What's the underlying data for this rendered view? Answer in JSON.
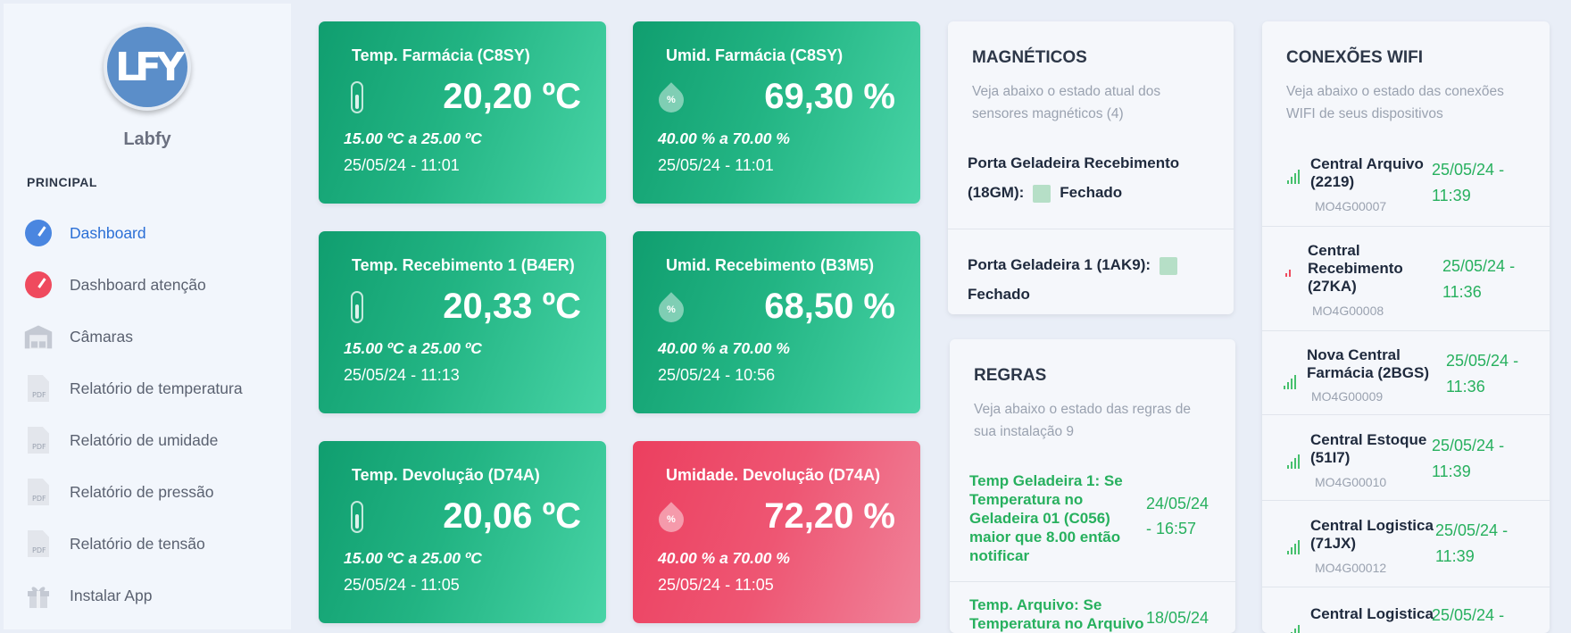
{
  "sidebar": {
    "logo_text": "LFY",
    "brand": "Labfy",
    "section": "PRINCIPAL",
    "items": [
      {
        "label": "Dashboard",
        "icon": "gauge-blue-icon"
      },
      {
        "label": "Dashboard atenção",
        "icon": "gauge-red-icon"
      },
      {
        "label": "Câmaras",
        "icon": "warehouse-icon"
      },
      {
        "label": "Relatório de temperatura",
        "icon": "pdf-icon"
      },
      {
        "label": "Relatório de umidade",
        "icon": "pdf-icon"
      },
      {
        "label": "Relatório de pressão",
        "icon": "pdf-icon"
      },
      {
        "label": "Relatório de tensão",
        "icon": "pdf-icon"
      },
      {
        "label": "Instalar App",
        "icon": "gift-icon"
      }
    ]
  },
  "cards": [
    {
      "title": "Temp. Farmácia (C8SY)",
      "value": "20,20 ºC",
      "range": "15.00 ºC a 25.00 ºC",
      "time": "25/05/24 - 11:01",
      "kind": "temperature",
      "status": "ok"
    },
    {
      "title": "Umid. Farmácia (C8SY)",
      "value": "69,30 %",
      "range": "40.00 % a 70.00 %",
      "time": "25/05/24 - 11:01",
      "kind": "humidity",
      "status": "ok"
    },
    {
      "title": "Temp. Recebimento 1 (B4ER)",
      "value": "20,33 ºC",
      "range": "15.00 ºC a 25.00 ºC",
      "time": "25/05/24 - 11:13",
      "kind": "temperature",
      "status": "ok"
    },
    {
      "title": "Umid. Recebimento (B3M5)",
      "value": "68,50 %",
      "range": "40.00 % a 70.00 %",
      "time": "25/05/24 - 10:56",
      "kind": "humidity",
      "status": "ok"
    },
    {
      "title": "Temp. Devolução (D74A)",
      "value": "20,06 ºC",
      "range": "15.00 ºC a 25.00 ºC",
      "time": "25/05/24 - 11:05",
      "kind": "temperature",
      "status": "ok"
    },
    {
      "title": "Umidade. Devolução (D74A)",
      "value": "72,20 %",
      "range": "40.00 % a 70.00 %",
      "time": "25/05/24 - 11:05",
      "kind": "humidity",
      "status": "alert"
    }
  ],
  "magneticos": {
    "title": "MAGNÉTICOS",
    "subtitle_1": "Veja abaixo o estado atual dos",
    "subtitle_2": "sensores magnéticos (4)",
    "items": [
      {
        "name_1": "Porta Geladeira Recebimento",
        "name_2": "(18GM):",
        "state": "Fechado"
      },
      {
        "name_1": "Porta Geladeira 1 (1AK9):",
        "name_2": "",
        "state": "Fechado"
      }
    ]
  },
  "regras": {
    "title": "REGRAS",
    "subtitle_1": "Veja abaixo o estado das regras de",
    "subtitle_2": "sua instalação 9",
    "items": [
      {
        "line_1": "Temp Geladeira 1: Se",
        "line_2": "Temperatura no",
        "line_3": "Geladeira 01 (C056)",
        "line_4": "maior que 8.00 então",
        "line_5": "notificar",
        "date_1": "24/05/24",
        "date_2": "- 16:57"
      },
      {
        "line_1": "Temp. Arquivo: Se",
        "line_2": "Temperatura no Arquivo",
        "date_1": "18/05/24"
      }
    ]
  },
  "wifi": {
    "title": "CONEXÕES WIFI",
    "subtitle_1": "Veja abaixo o estado das conexões",
    "subtitle_2": "WIFI de seus dispositivos",
    "items": [
      {
        "name_1": "Central Arquivo",
        "name_2": "(2219)",
        "name_3": "",
        "id": "MO4G00007",
        "date_1": "25/05/24 -",
        "date_2": "11:39",
        "signal": "good"
      },
      {
        "name_1": "Central",
        "name_2": "Recebimento",
        "name_3": "(27KA)",
        "id": "MO4G00008",
        "date_1": "25/05/24 -",
        "date_2": "11:36",
        "signal": "bad"
      },
      {
        "name_1": "Nova Central",
        "name_2": "Farmácia (2BGS)",
        "name_3": "",
        "id": "MO4G00009",
        "date_1": "25/05/24 -",
        "date_2": "11:36",
        "signal": "good"
      },
      {
        "name_1": "Central Estoque",
        "name_2": "(51I7)",
        "name_3": "",
        "id": "MO4G00010",
        "date_1": "25/05/24 -",
        "date_2": "11:39",
        "signal": "good"
      },
      {
        "name_1": "Central Logistica",
        "name_2": "(71JX)",
        "name_3": "",
        "id": "MO4G00012",
        "date_1": "25/05/24 -",
        "date_2": "11:39",
        "signal": "good"
      },
      {
        "name_1": "Central Logistica",
        "name_2": "",
        "name_3": "",
        "id": "",
        "date_1": "25/05/24 -",
        "date_2": "",
        "signal": "good"
      }
    ]
  },
  "colors": {
    "ok_card": "#22b483",
    "alert_card": "#ee5673",
    "accent": "#2b6fd6",
    "ok_text": "#27b05e"
  }
}
